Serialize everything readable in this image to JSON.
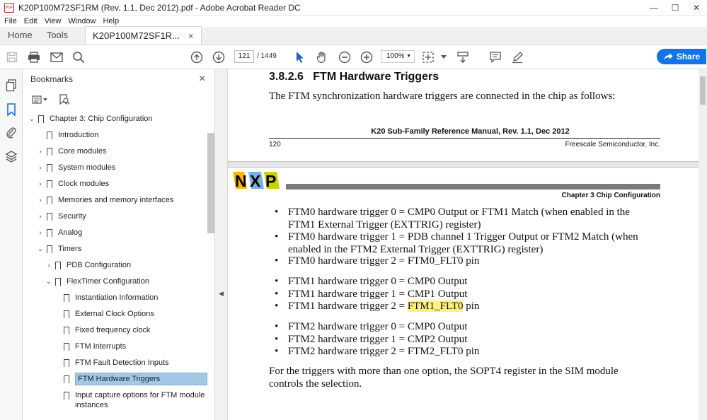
{
  "window": {
    "title": "K20P100M72SF1RM (Rev. 1.1, Dec 2012).pdf - Adobe Acrobat Reader DC",
    "app_icon_label": "PDF",
    "minimize": "—",
    "maximize": "☐",
    "close": "✕"
  },
  "menu": [
    "File",
    "Edit",
    "View",
    "Window",
    "Help"
  ],
  "tabs": {
    "home": "Home",
    "tools": "Tools",
    "document": "K20P100M72SF1R...",
    "close": "×"
  },
  "toolbar": {
    "page_current": "121",
    "page_total": "/ 1449",
    "zoom": "100%",
    "share_label": "Share",
    "accent": "#1473e6"
  },
  "bookmarks_panel": {
    "title": "Bookmarks",
    "close": "×",
    "items": [
      {
        "label": "Chapter 3: Chip Configuration",
        "arrow": "⌄",
        "level": 0
      },
      {
        "label": "Introduction",
        "arrow": "",
        "level": 1
      },
      {
        "label": "Core modules",
        "arrow": "›",
        "level": 1
      },
      {
        "label": "System modules",
        "arrow": "›",
        "level": 1
      },
      {
        "label": "Clock modules",
        "arrow": "›",
        "level": 1
      },
      {
        "label": "Memories and memory interfaces",
        "arrow": "›",
        "level": 1
      },
      {
        "label": "Security",
        "arrow": "›",
        "level": 1
      },
      {
        "label": "Analog",
        "arrow": "›",
        "level": 1
      },
      {
        "label": "Timers",
        "arrow": "⌄",
        "level": 1
      },
      {
        "label": "PDB Configuration",
        "arrow": "›",
        "level": 2
      },
      {
        "label": "FlexTimer Configuration",
        "arrow": "⌄",
        "level": 2
      },
      {
        "label": "Instantiation Information",
        "arrow": "",
        "level": 3
      },
      {
        "label": "External Clock Options",
        "arrow": "",
        "level": 3
      },
      {
        "label": "Fixed frequency clock",
        "arrow": "",
        "level": 3
      },
      {
        "label": "FTM Interrupts",
        "arrow": "",
        "level": 3
      },
      {
        "label": "FTM Fault Detection Inputs",
        "arrow": "",
        "level": 3
      },
      {
        "label": "FTM Hardware Triggers",
        "arrow": "",
        "level": 3,
        "selected": true
      },
      {
        "label": "Input capture options for FTM module",
        "arrow": "",
        "level": 3
      },
      {
        "label": "instances",
        "arrow": "",
        "level": 3,
        "continuation": true
      }
    ]
  },
  "document": {
    "section_heading": "3.8.2.6   FTM Hardware Triggers",
    "intro": "The FTM synchronization hardware triggers are connected in the chip as follows:",
    "footer_center": "K20 Sub-Family Reference Manual, Rev. 1.1, Dec 2012",
    "footer_page": "120",
    "footer_right": "Freescale Semiconductor, Inc.",
    "chapter_header": "Chapter 3 Chip Configuration",
    "logo_text": "NXP",
    "bullet_char": "•",
    "bullets": [
      {
        "line1": "FTM0 hardware trigger 0 = CMP0 Output or FTM1 Match (when enabled in the",
        "line2": "FTM1 External Trigger (EXTTRIG) register)"
      },
      {
        "line1": "FTM0 hardware trigger 1 = PDB channel 1 Trigger Output or FTM2 Match (when",
        "line2": "enabled in the FTM2 External Trigger (EXTTRIG) register)"
      },
      {
        "line1": "FTM0 hardware trigger 2 = FTM0_FLT0 pin"
      },
      {
        "line1": "FTM1 hardware trigger 0 = CMP0 Output"
      },
      {
        "line1": "FTM1 hardware trigger 1 = CMP1 Output"
      },
      {
        "pre": "FTM1 hardware trigger 2 = ",
        "highlight": "FTM1_FLT0",
        "post": " pin"
      },
      {
        "line1": "FTM2 hardware trigger 0 = CMP0 Output"
      },
      {
        "line1": "FTM2 hardware trigger 1 = CMP2 Output"
      },
      {
        "line1": "FTM2 hardware trigger 2 = FTM2_FLT0 pin"
      }
    ],
    "closing_line1": "For the triggers with more than one option, the SOPT4 register in the SIM module",
    "closing_line2": "controls the selection."
  }
}
